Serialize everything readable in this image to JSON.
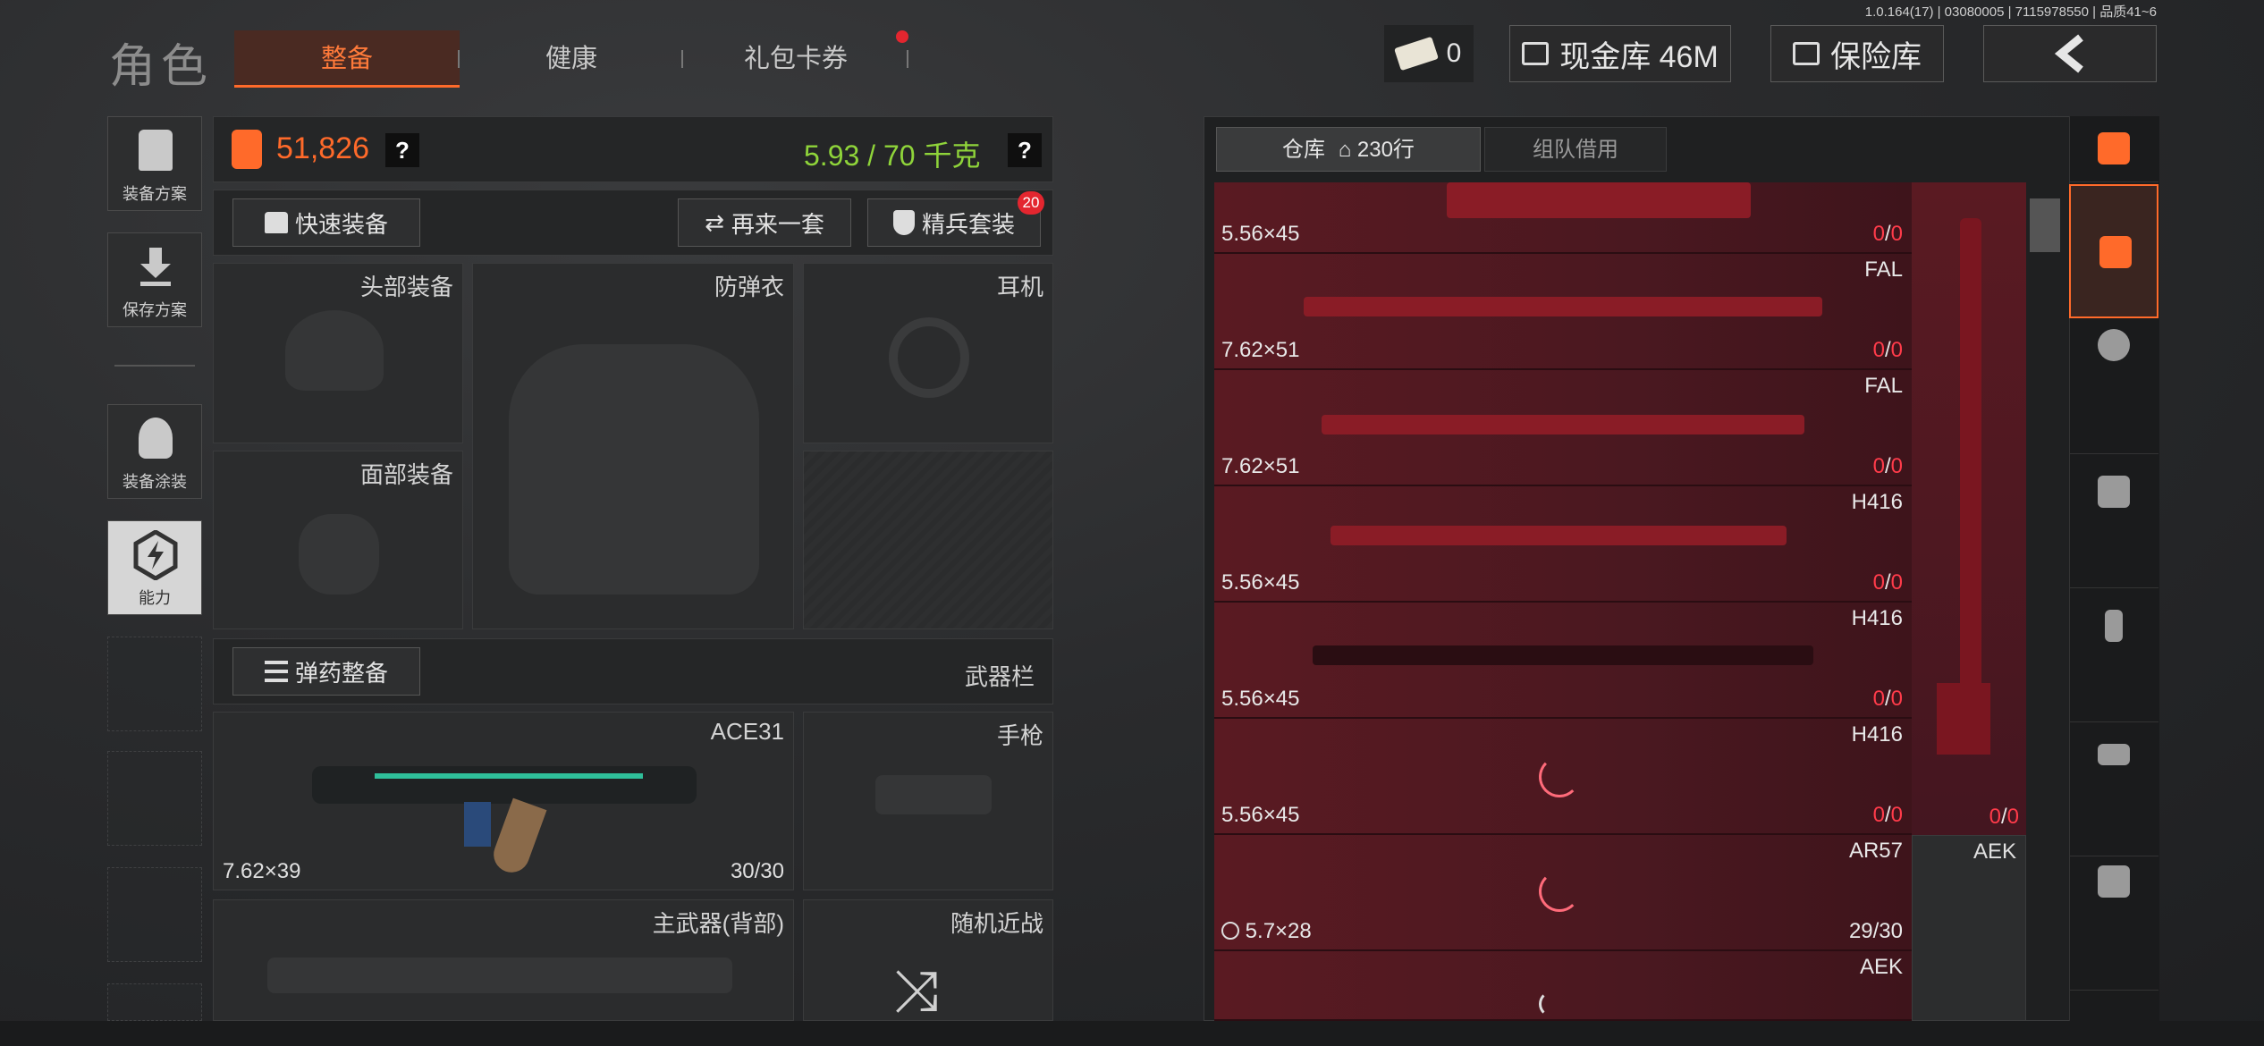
{
  "version": "1.0.164(17) | 03080005 | 7115978550 | 品质41~6",
  "role_title": "角色",
  "tabs": [
    {
      "label": "整备",
      "active": true
    },
    {
      "label": "健康",
      "active": false
    },
    {
      "label": "礼包卡券",
      "active": false
    }
  ],
  "currency": {
    "tickets": "0"
  },
  "cash_vault": "现金库 46M",
  "safe_box": "保险库",
  "left_menu": [
    {
      "label": "装备方案"
    },
    {
      "label": "保存方案"
    },
    {
      "label": "装备涂装"
    },
    {
      "label": "能力"
    }
  ],
  "value": "51,826",
  "weight": "5.93 / 70 千克",
  "help": "?",
  "buttons": {
    "quick_equip": "快速装备",
    "again": "再来一套",
    "elite": "精兵套装",
    "elite_badge": "20",
    "ammo": "弹药整备"
  },
  "slots": {
    "head": "头部装备",
    "armor": "防弹衣",
    "headset": "耳机",
    "face": "面部装备",
    "weapon_bar": "武器栏",
    "primary": "ACE31",
    "primary_caliber": "7.62×39",
    "primary_ammo": "30/30",
    "pistol": "手枪",
    "primary_back": "主武器(背部)",
    "melee": "随机近战"
  },
  "stash": {
    "tab_warehouse": "仓库",
    "rows_count": "230行",
    "tab_team": "组队借用",
    "items": [
      {
        "name": "",
        "caliber": "5.56×45",
        "dur_a": "0",
        "dur_b": "0"
      },
      {
        "name": "FAL",
        "caliber": "7.62×51",
        "dur_a": "0",
        "dur_b": "0"
      },
      {
        "name": "FAL",
        "caliber": "7.62×51",
        "dur_a": "0",
        "dur_b": "0"
      },
      {
        "name": "H416",
        "caliber": "5.56×45",
        "dur_a": "0",
        "dur_b": "0"
      },
      {
        "name": "H416",
        "caliber": "5.56×45",
        "dur_a": "0",
        "dur_b": "0"
      },
      {
        "name": "H416",
        "caliber": "5.56×45",
        "dur_a": "0",
        "dur_b": "0"
      },
      {
        "name": "AR57",
        "caliber": "5.7×28",
        "ammo": "29/30"
      },
      {
        "name": "AEK",
        "caliber": ""
      }
    ],
    "vertical_item": {
      "dur_a": "0",
      "dur_b": "0"
    },
    "side_item": "AEK",
    "slash": "/"
  },
  "colors": {
    "accent": "#ff6a2a",
    "weight_green": "#8fd43a",
    "durability_red": "#ff3b4a"
  }
}
